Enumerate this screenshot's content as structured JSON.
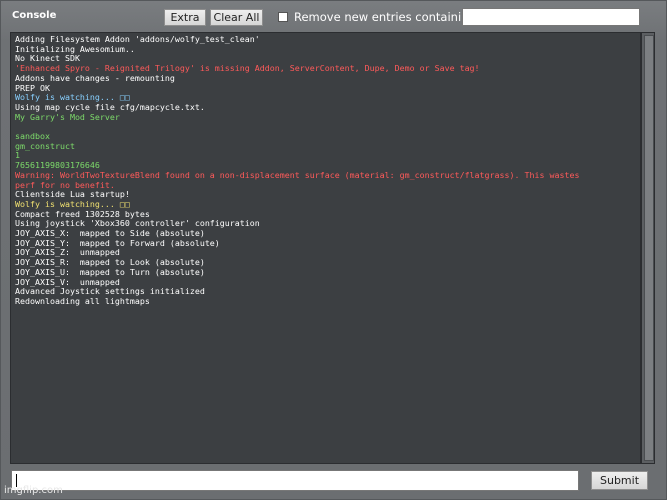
{
  "window": {
    "title": "Console"
  },
  "toolbar": {
    "extra_label": "Extra",
    "clear_label": "Clear All",
    "filter_label": "Remove new entries containing:",
    "filter_value": ""
  },
  "console_lines": [
    {
      "text": "Adding Filesystem Addon 'addons/wolfy_test_clean'",
      "color": "#ffffff"
    },
    {
      "text": "Initializing Awesomium..",
      "color": "#ffffff"
    },
    {
      "text": "No Kinect SDK",
      "color": "#ffffff"
    },
    {
      "text": "'Enhanced Spyro - Reignited Trilogy' is missing Addon, ServerContent, Dupe, Demo or Save tag!",
      "color": "#ff5a5a"
    },
    {
      "text": "Addons have changes - remounting",
      "color": "#ffffff"
    },
    {
      "text": "PREP OK",
      "color": "#ffffff"
    },
    {
      "text": "Wolfy is watching... □□",
      "color": "#88d0ff"
    },
    {
      "text": "Using map cycle file cfg/mapcycle.txt.",
      "color": "#ffffff"
    },
    {
      "text": "My Garry's Mod Server",
      "color": "#7ddb6a"
    },
    {
      "text": "",
      "color": "#ffffff"
    },
    {
      "text": "sandbox",
      "color": "#7ddb6a"
    },
    {
      "text": "gm_construct",
      "color": "#7ddb6a"
    },
    {
      "text": "1",
      "color": "#7ddb6a"
    },
    {
      "text": "76561199803176646",
      "color": "#7ddb6a"
    },
    {
      "text": "Warning: WorldTwoTextureBlend found on a non-displacement surface (material: gm_construct/flatgrass). This wastes",
      "color": "#ff5a5a"
    },
    {
      "text": "perf for no benefit.",
      "color": "#ff5a5a"
    },
    {
      "text": "Clientside Lua startup!",
      "color": "#ffffff"
    },
    {
      "text": "Wolfy is watching... □□",
      "color": "#f0e070"
    },
    {
      "text": "Compact freed 1302528 bytes",
      "color": "#ffffff"
    },
    {
      "text": "Using joystick 'Xbox360 controller' configuration",
      "color": "#ffffff"
    },
    {
      "text": "JOY_AXIS_X:  mapped to Side (absolute)",
      "color": "#ffffff"
    },
    {
      "text": "JOY_AXIS_Y:  mapped to Forward (absolute)",
      "color": "#ffffff"
    },
    {
      "text": "JOY_AXIS_Z:  unmapped",
      "color": "#ffffff"
    },
    {
      "text": "JOY_AXIS_R:  mapped to Look (absolute)",
      "color": "#ffffff"
    },
    {
      "text": "JOY_AXIS_U:  mapped to Turn (absolute)",
      "color": "#ffffff"
    },
    {
      "text": "JOY_AXIS_V:  unmapped",
      "color": "#ffffff"
    },
    {
      "text": "Advanced Joystick settings initialized",
      "color": "#ffffff"
    },
    {
      "text": "Redownloading all lightmaps",
      "color": "#ffffff"
    }
  ],
  "command": {
    "value": "",
    "submit_label": "Submit"
  },
  "watermark": "imgflip.com"
}
